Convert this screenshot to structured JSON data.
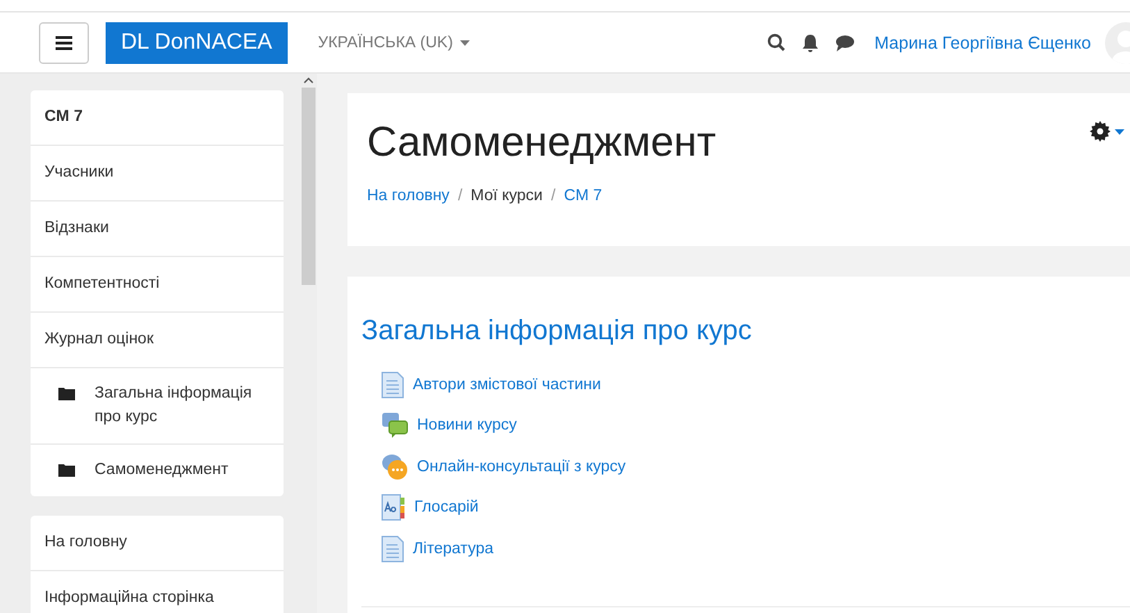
{
  "navbar": {
    "brand": "DL DonNACEA",
    "language": "УКРАЇНСЬКА (UK)",
    "user_name": "Марина Георгіївна Єщенко"
  },
  "sidebar": {
    "blocks": [
      {
        "items": [
          {
            "label": "CM 7",
            "kind": "course"
          },
          {
            "label": "Учасники",
            "kind": "link"
          },
          {
            "label": "Відзнаки",
            "kind": "link"
          },
          {
            "label": "Компетентності",
            "kind": "link"
          },
          {
            "label": "Журнал оцінок",
            "kind": "link"
          },
          {
            "label": "Загальна інформація про курс",
            "kind": "section"
          },
          {
            "label": "Самоменеджмент",
            "kind": "section"
          }
        ]
      },
      {
        "items": [
          {
            "label": "На головну",
            "kind": "link"
          },
          {
            "label": "Інформаційна сторінка",
            "kind": "link"
          }
        ]
      }
    ]
  },
  "header": {
    "title": "Самоменеджмент",
    "breadcrumb_separator": "/",
    "breadcrumb": [
      {
        "label": "На головну",
        "link": true
      },
      {
        "label": "Мої курси",
        "link": false
      },
      {
        "label": "CM 7",
        "link": true
      }
    ]
  },
  "section": {
    "title": "Загальна інформація про курс",
    "activities": [
      {
        "label": "Автори змістової частини",
        "kind": "page"
      },
      {
        "label": "Новини курсу",
        "kind": "forum"
      },
      {
        "label": "Онлайн-консультації з курсу",
        "kind": "chat"
      },
      {
        "label": "Глосарій",
        "kind": "glossary"
      },
      {
        "label": "Література",
        "kind": "page"
      }
    ]
  }
}
